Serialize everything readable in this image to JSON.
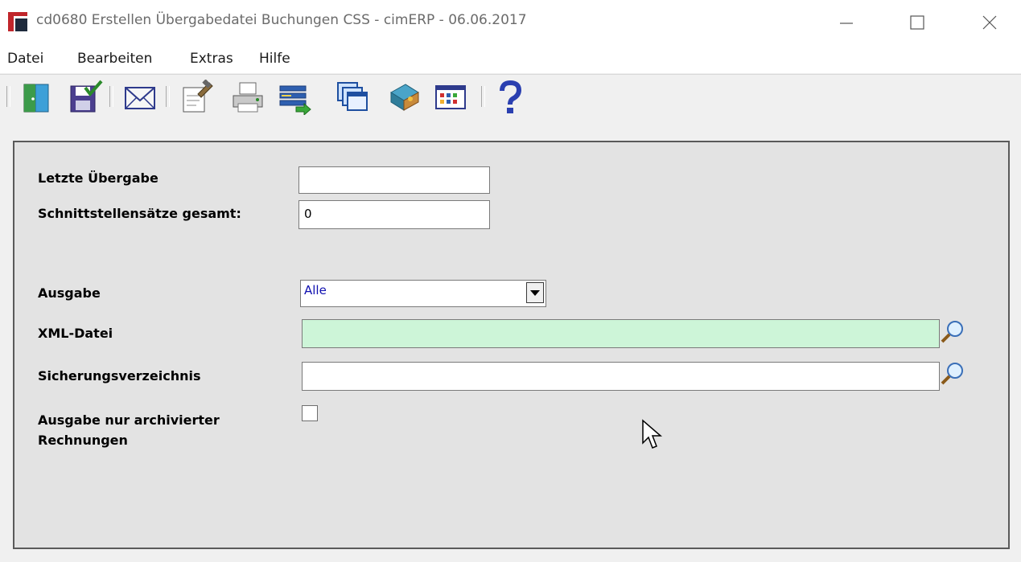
{
  "window": {
    "title": "cd0680 Erstellen Übergabedatei Buchungen CSS - cimERP - 06.06.2017"
  },
  "menu": {
    "items": [
      "Datei",
      "Bearbeiten",
      "Extras",
      "Hilfe"
    ]
  },
  "toolbar": {
    "buttons": [
      {
        "icon": "exit-door-icon"
      },
      {
        "icon": "save-check-icon"
      },
      {
        "icon": "mail-icon"
      },
      {
        "icon": "edit-note-icon"
      },
      {
        "icon": "printer-icon"
      },
      {
        "icon": "transfer-list-icon"
      },
      {
        "icon": "windows-icon"
      },
      {
        "icon": "book-icon"
      },
      {
        "icon": "grid-icon"
      },
      {
        "icon": "help-icon"
      }
    ]
  },
  "form": {
    "letzte_uebergabe": {
      "label": "Letzte Übergabe",
      "value": ""
    },
    "schnittstellensaetze": {
      "label": "Schnittstellensätze gesamt:",
      "value": "0"
    },
    "ausgabe": {
      "label": "Ausgabe",
      "selected": "Alle"
    },
    "xml_datei": {
      "label": "XML-Datei",
      "value": "",
      "bg": "#cdf5d8"
    },
    "sicherungsverzeichnis": {
      "label": "Sicherungsverzeichnis",
      "value": ""
    },
    "nur_archiviert": {
      "label_line1": "Ausgabe nur archivierter",
      "label_line2": "Rechnungen",
      "checked": false
    }
  },
  "colors": {
    "accent_red": "#c0262b",
    "panel_bg": "#e3e3e3",
    "required_field_bg": "#cdf5d8"
  }
}
